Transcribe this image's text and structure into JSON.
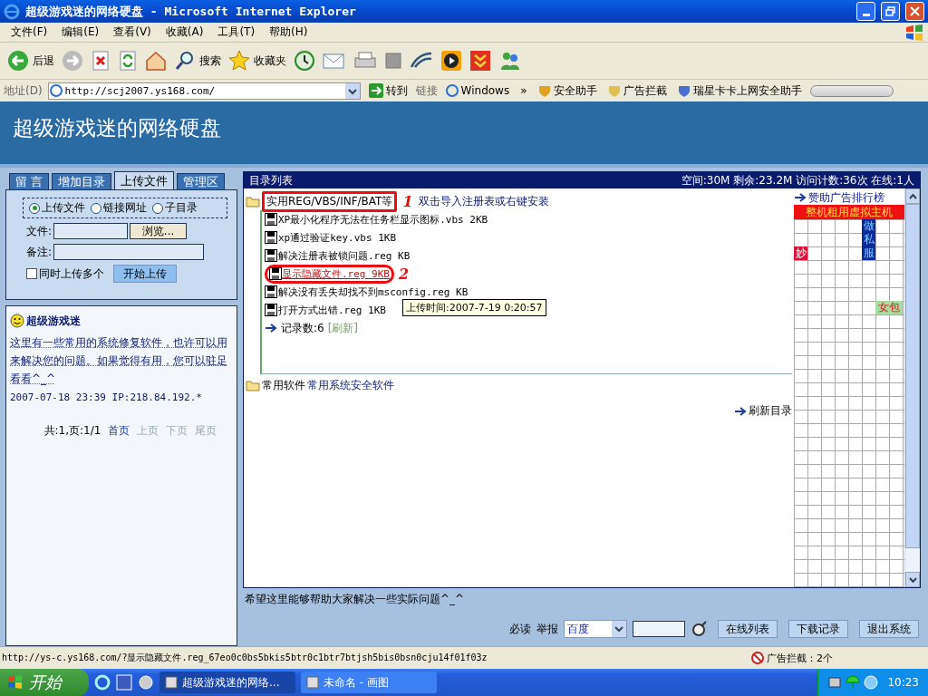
{
  "window": {
    "title": "超级游戏迷的网络硬盘 - Microsoft Internet Explorer"
  },
  "menu": [
    "文件(F)",
    "编辑(E)",
    "查看(V)",
    "收藏(A)",
    "工具(T)",
    "帮助(H)"
  ],
  "toolbar": [
    {
      "kind": "back",
      "label": "后退"
    },
    {
      "kind": "forward"
    },
    {
      "kind": "stop"
    },
    {
      "kind": "refresh"
    },
    {
      "kind": "home"
    },
    {
      "kind": "search",
      "label": "搜索"
    },
    {
      "kind": "favorites",
      "label": "收藏夹"
    },
    {
      "kind": "history"
    },
    {
      "kind": "mail"
    },
    {
      "kind": "print"
    },
    {
      "kind": "edit"
    },
    {
      "kind": "discuss"
    },
    {
      "kind": "media"
    },
    {
      "kind": "download"
    },
    {
      "kind": "messenger"
    }
  ],
  "address_bar": {
    "label": "地址(D)",
    "value": "http://scj2007.ys168.com/",
    "go": "转到",
    "links_label": "链接",
    "links": [
      "Windows"
    ],
    "chevron": "»",
    "addons": [
      "安全助手",
      "广告拦截",
      "瑞星卡卡上网安全助手"
    ]
  },
  "page": {
    "site_title": "超级游戏迷的网络硬盘",
    "tabs": [
      {
        "label": "留 言",
        "selected": false
      },
      {
        "label": "增加目录",
        "selected": false
      },
      {
        "label": "上传文件",
        "selected": true
      },
      {
        "label": "管理区",
        "selected": false
      }
    ],
    "upload_form": {
      "modes": [
        {
          "label": "上传文件",
          "selected": true
        },
        {
          "label": "链接网址",
          "selected": false
        },
        {
          "label": "子目录",
          "selected": false
        }
      ],
      "file_label": "文件:",
      "browse": "浏览...",
      "note_label": "备注:",
      "multi": {
        "label": "同时上传多个",
        "checked": false
      },
      "submit": "开始上传"
    },
    "guestbook": {
      "author": "超级游戏迷",
      "message": "这里有一些常用的系统修复软件，也许可以用来解决您的问题。如果觉得有用，您可以驻足看看^_^",
      "meta": "2007-07-18 23:39 IP:218.84.192.*",
      "summary": "共:1,页:1/1",
      "pages": [
        {
          "label": "首页",
          "disabled": false
        },
        {
          "label": "上页",
          "disabled": true
        },
        {
          "label": "下页",
          "disabled": true
        },
        {
          "label": "尾页",
          "disabled": true
        }
      ]
    },
    "directory": {
      "title": "目录列表",
      "stats": "空间:30M 剩余:23.2M 访问计数:36次 在线:1人",
      "folders": [
        {
          "name": "实用REG/VBS/INF/BAT等",
          "annotation": "1",
          "description": "双击导入注册表或右键安装",
          "expanded": true,
          "files": [
            {
              "name": "XP最小化程序无法在任务栏显示图标.vbs 2KB",
              "hovered": false
            },
            {
              "name": "xp通过验证key.vbs 1KB",
              "hovered": false
            },
            {
              "name": "解决注册表被锁问题.reg KB",
              "hovered": false
            },
            {
              "name": "显示隐藏文件.reg 9KB",
              "hovered": true,
              "annotation": "2"
            },
            {
              "name": "解决没有丢失却找不到msconfig.reg KB",
              "hovered": false
            },
            {
              "name": "打开方式出错.reg 1KB",
              "hovered": false
            }
          ],
          "record_count": "记录数:6",
          "refresh": "[刷新]"
        },
        {
          "name": "常用软件",
          "description": "常用系统安全软件",
          "expanded": false
        }
      ],
      "tooltip": "上传时间:2007-7-19 0:20:57",
      "refresh_dir": "刷新目录"
    },
    "ads": {
      "title": "赞助广告排行榜",
      "banner": "整机租用虚拟主机",
      "spots": [
        {
          "text": "妙",
          "color": "#e0103c"
        },
        {
          "text": "做私服",
          "color": "#0c2a9c"
        },
        {
          "text": "女包",
          "color": "#a8dca0"
        }
      ]
    },
    "footer": {
      "note": "希望这里能够帮助大家解决一些实际问题^_^",
      "links": [
        "必读",
        "举报"
      ],
      "engine": "百度",
      "buttons": [
        "在线列表",
        "下载记录",
        "退出系统"
      ]
    }
  },
  "status_bar": {
    "url": "http://ys-c.ys168.com/?显示隐藏文件.reg_67eo0c0bs5bkis5btr0c1btr7btjsh5bis0bsn0cju14f01f03z",
    "adblock": "广告拦截：2个"
  },
  "taskbar": {
    "start": "开始",
    "tasks": [
      {
        "label": "超级游戏迷的网络...",
        "selected": true
      },
      {
        "label": "未命名 - 画图",
        "selected": false
      }
    ],
    "clock": "10:23"
  }
}
